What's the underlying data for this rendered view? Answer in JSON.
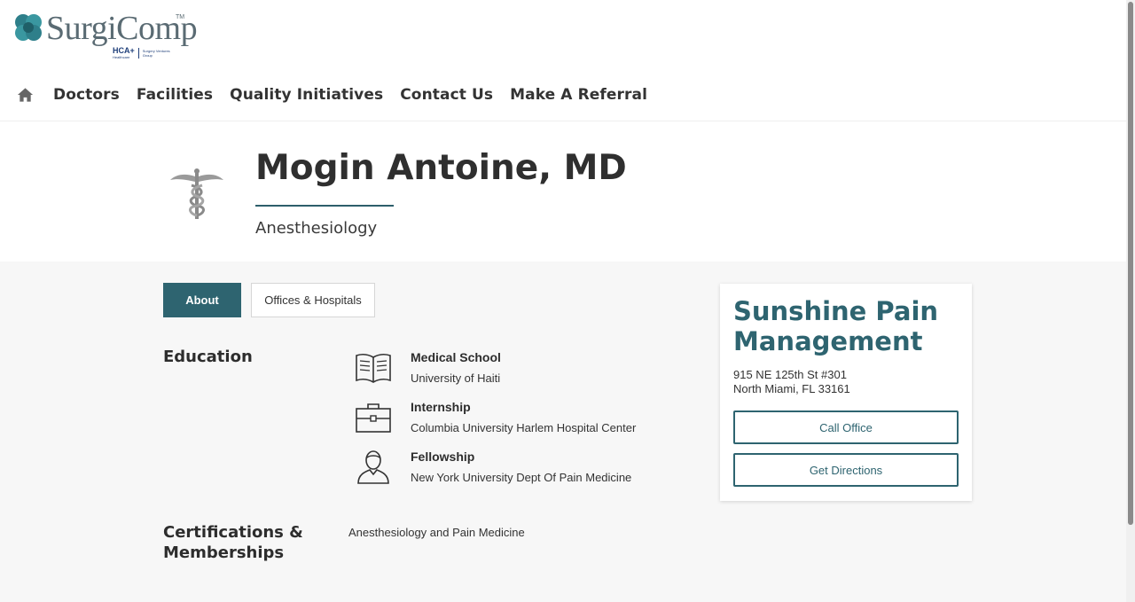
{
  "brand": {
    "name": "SurgiComp",
    "tm": "TM",
    "parent": "HCA+",
    "parent_sub": "Healthcare",
    "group": "Surgery Ventures Group"
  },
  "nav": {
    "items": [
      "Doctors",
      "Facilities",
      "Quality Initiatives",
      "Contact Us",
      "Make A Referral"
    ]
  },
  "doctor": {
    "name": "Mogin Antoine, MD",
    "specialty": "Anesthesiology"
  },
  "tabs": {
    "about": "About",
    "offices": "Offices & Hospitals"
  },
  "education": {
    "title": "Education",
    "items": [
      {
        "label": "Medical School",
        "value": "University of Haiti",
        "icon": "open-book-icon"
      },
      {
        "label": "Internship",
        "value": "Columbia University Harlem Hospital Center",
        "icon": "briefcase-icon"
      },
      {
        "label": "Fellowship",
        "value": "New York University Dept Of Pain Medicine",
        "icon": "person-icon"
      }
    ]
  },
  "certifications": {
    "title": "Certifications & Memberships",
    "value": "Anesthesiology and Pain Medicine"
  },
  "office": {
    "name": "Sunshine Pain Management",
    "address_line1": "915 NE 125th St #301",
    "address_line2": "North Miami, FL 33161",
    "call_label": "Call Office",
    "directions_label": "Get Directions"
  },
  "colors": {
    "accent": "#2e6470",
    "background": "#f7f7f7"
  }
}
